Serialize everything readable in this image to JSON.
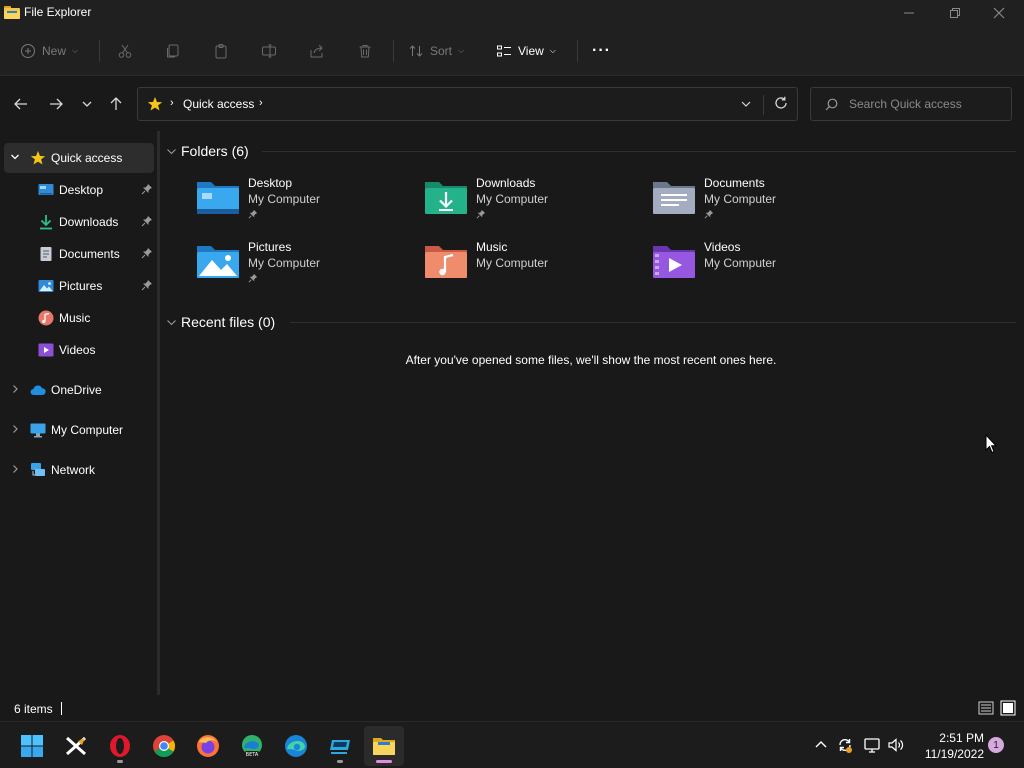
{
  "window": {
    "title": "File Explorer"
  },
  "toolbar": {
    "new_label": "New",
    "sort_label": "Sort",
    "view_label": "View",
    "more_label": "···"
  },
  "address": {
    "crumb": "Quick access",
    "separator": "›"
  },
  "search": {
    "placeholder": "Search Quick access"
  },
  "sidebar": {
    "items": [
      {
        "label": "Quick access",
        "icon": "star-icon"
      },
      {
        "label": "Desktop",
        "icon": "desktop-icon",
        "pinned": true
      },
      {
        "label": "Downloads",
        "icon": "download-icon",
        "pinned": true
      },
      {
        "label": "Documents",
        "icon": "document-icon",
        "pinned": true
      },
      {
        "label": "Pictures",
        "icon": "pictures-icon",
        "pinned": true
      },
      {
        "label": "Music",
        "icon": "music-icon"
      },
      {
        "label": "Videos",
        "icon": "videos-icon"
      },
      {
        "label": "OneDrive",
        "icon": "onedrive-icon"
      },
      {
        "label": "My Computer",
        "icon": "computer-icon"
      },
      {
        "label": "Network",
        "icon": "network-icon"
      }
    ]
  },
  "main": {
    "folders_heading": "Folders (6)",
    "folders": [
      {
        "name": "Desktop",
        "location": "My Computer",
        "pinned": true,
        "color": "#3aa0e6"
      },
      {
        "name": "Downloads",
        "location": "My Computer",
        "pinned": true,
        "color": "#24b28a"
      },
      {
        "name": "Documents",
        "location": "My Computer",
        "pinned": true,
        "color": "#8a97ad"
      },
      {
        "name": "Pictures",
        "location": "My Computer",
        "pinned": true,
        "color": "#3aa0e6"
      },
      {
        "name": "Music",
        "location": "My Computer",
        "pinned": false,
        "color": "#e87a5a"
      },
      {
        "name": "Videos",
        "location": "My Computer",
        "pinned": false,
        "color": "#8c4fd6"
      }
    ],
    "recent_heading": "Recent files (0)",
    "recent_empty_message": "After you've opened some files, we'll show the most recent ones here."
  },
  "status": {
    "item_count": "6 items"
  },
  "taskbar": {
    "time": "2:51 PM",
    "date": "11/19/2022",
    "notification_count": "1",
    "apps": [
      "start",
      "x-app",
      "opera",
      "chrome",
      "firefox",
      "edge-beta",
      "edge",
      "remote-app",
      "file-explorer"
    ]
  },
  "colors": {
    "background": "#191919",
    "chrome": "#202020",
    "accent_star": "#f5c518",
    "selected": "#2d2d2d"
  }
}
